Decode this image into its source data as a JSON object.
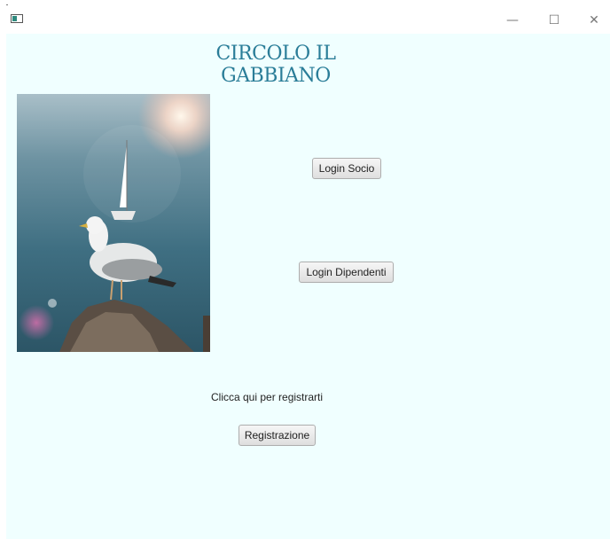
{
  "window": {
    "minimize_glyph": "—",
    "maximize_glyph": "☐",
    "close_glyph": "✕"
  },
  "main": {
    "title": "CIRCOLO IL GABBIANO",
    "login_socio_label": "Login Socio",
    "login_dipendenti_label": "Login Dipendenti",
    "register_hint": "Clicca qui per registrarti",
    "register_label": "Registrazione"
  },
  "colors": {
    "background": "#f0ffff",
    "title": "#2a7d98"
  }
}
